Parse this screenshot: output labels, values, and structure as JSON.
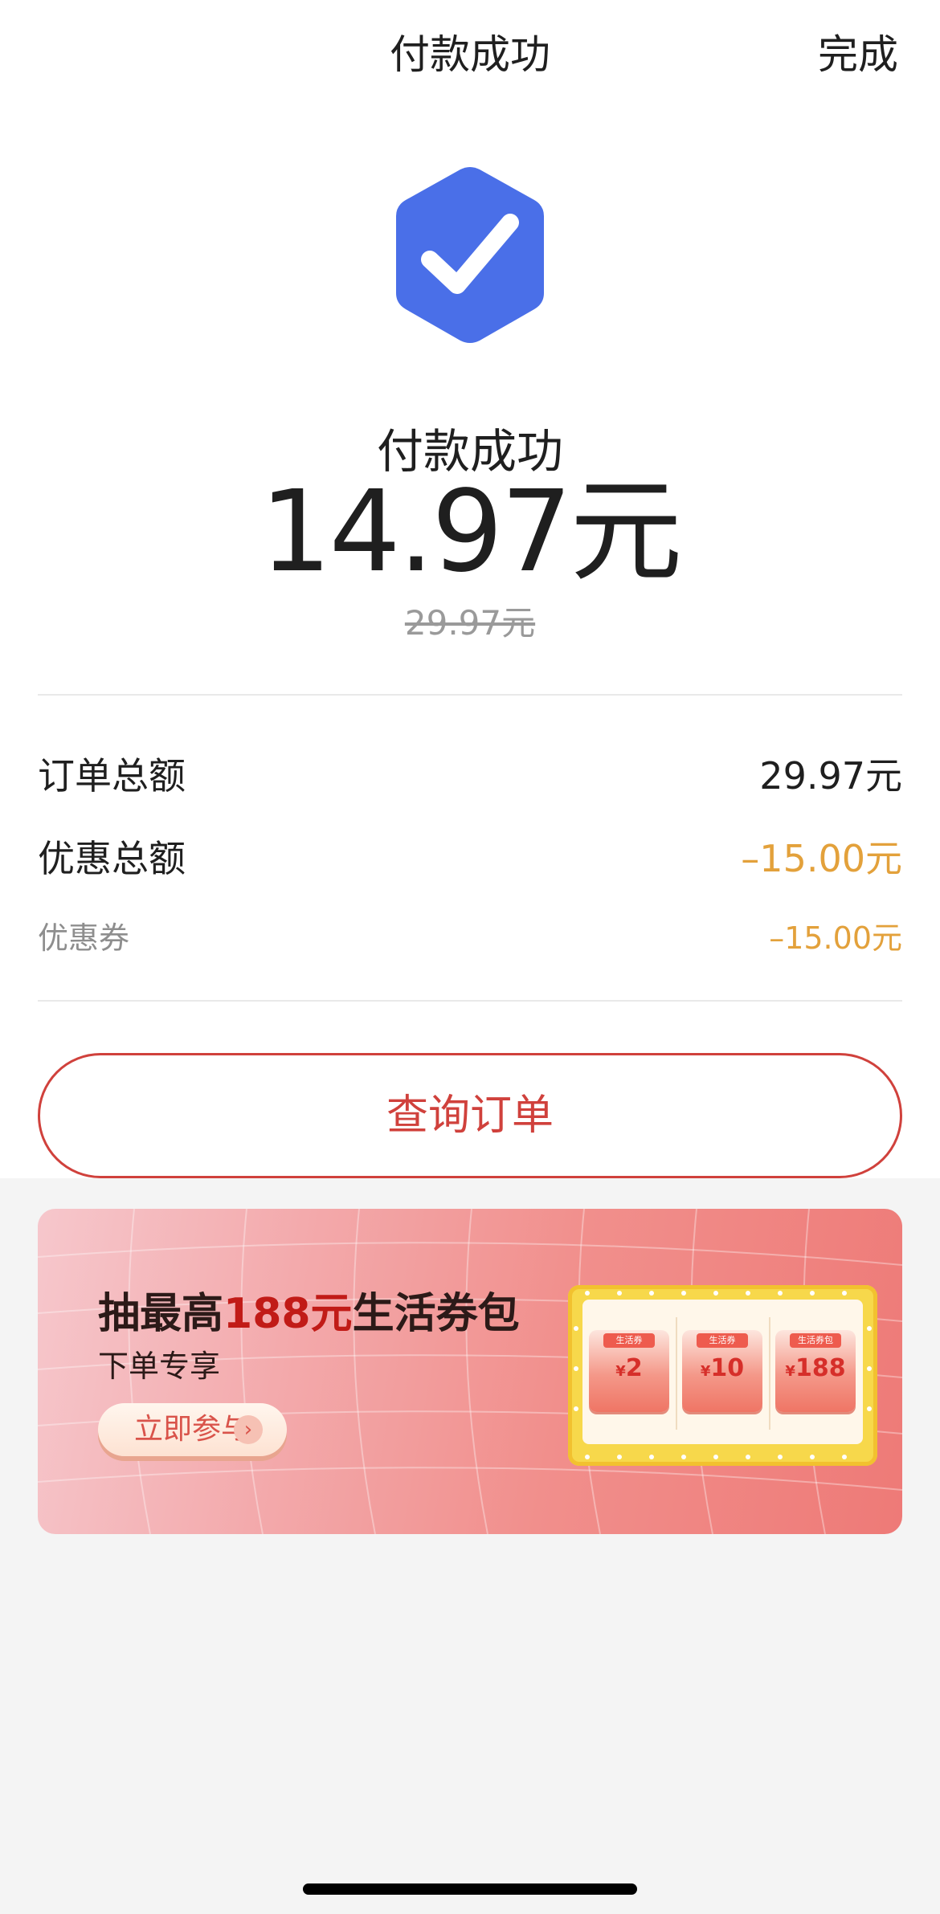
{
  "header": {
    "title": "付款成功",
    "done_label": "完成"
  },
  "result": {
    "status_text": "付款成功",
    "amount": "14.97元",
    "original_amount": "29.97元"
  },
  "summary": {
    "rows": [
      {
        "label": "订单总额",
        "value": "29.97元"
      },
      {
        "label": "优惠总额",
        "value": "–15.00元"
      },
      {
        "label": "优惠券",
        "value": "–15.00元"
      }
    ]
  },
  "actions": {
    "query_order_label": "查询订单"
  },
  "banner": {
    "title_prefix": "抽最高",
    "title_highlight": "188元",
    "title_suffix": "生活券包",
    "subtitle": "下单专享",
    "cta_label": "立即参与",
    "cta_arrow": "›",
    "coupons": [
      {
        "tag": "生活券",
        "currency": "¥",
        "value": "2"
      },
      {
        "tag": "生活券",
        "currency": "¥",
        "value": "10"
      },
      {
        "tag": "生活券包",
        "currency": "¥",
        "value": "188"
      }
    ]
  },
  "colors": {
    "accent_blue": "#4a6fe8",
    "accent_red": "#d0413c",
    "discount_orange": "#e3a13b"
  },
  "icons": {
    "success": "hexagon-check-icon"
  }
}
